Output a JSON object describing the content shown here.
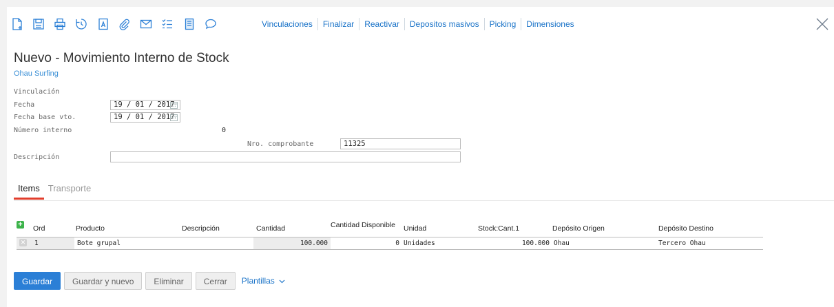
{
  "toolbar": {
    "icons": [
      "new-document-icon",
      "save-icon",
      "print-icon",
      "history-icon",
      "text-document-icon",
      "attach-icon",
      "email-icon",
      "checklist-icon",
      "notes-icon",
      "comment-icon"
    ],
    "links": [
      "Vinculaciones",
      "Finalizar",
      "Reactivar",
      "Depositos masivos",
      "Picking",
      "Dimensiones"
    ],
    "accent": "#1a73c8"
  },
  "header": {
    "title": "Nuevo - Movimiento Interno de Stock",
    "company": "Ohau Surfing"
  },
  "form": {
    "vinculacion_label": "Vinculación",
    "fecha_label": "Fecha",
    "fecha_value": "19 / 01 / 2017",
    "fecha_base_label": "Fecha base vto.",
    "fecha_base_value": "19 / 01 / 2017",
    "numero_interno_label": "Número interno",
    "numero_interno_value": "0",
    "nro_comprobante_label": "Nro. comprobante",
    "nro_comprobante_value": "11325",
    "descripcion_label": "Descripción",
    "descripcion_value": ""
  },
  "tabs": [
    {
      "label": "Items",
      "active": true
    },
    {
      "label": "Transporte",
      "active": false
    }
  ],
  "items_table": {
    "columns": [
      "Ord",
      "Producto",
      "Descripción",
      "Cantidad",
      "Cantidad Disponible",
      "Unidad",
      "Stock:Cant.1",
      "Depósito Origen",
      "Depósito Destino"
    ],
    "rows": [
      {
        "ord": "1",
        "producto": "Bote grupal",
        "descripcion": "",
        "cantidad": "100.000",
        "cantidad_disponible": "0",
        "unidad": "Unidades",
        "stock": "100.000",
        "deposito_origen": "Ohau",
        "deposito_destino": "Tercero Ohau"
      }
    ]
  },
  "actions": {
    "guardar": "Guardar",
    "guardar_nuevo": "Guardar y nuevo",
    "eliminar": "Eliminar",
    "cerrar": "Cerrar",
    "plantillas": "Plantillas"
  },
  "colors": {
    "primary_button": "#2b7fd6",
    "tab_underline": "#e23d2c",
    "add_green": "#3cb34a"
  }
}
